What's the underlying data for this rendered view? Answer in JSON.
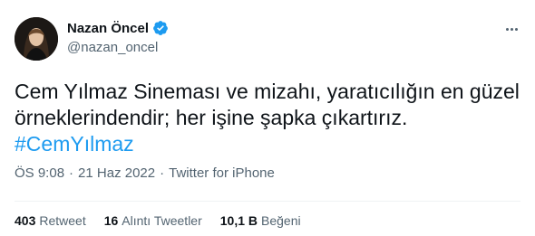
{
  "author": {
    "name": "Nazan Öncel",
    "handle": "@nazan_oncel",
    "verified": true
  },
  "tweet": {
    "line1": "Cem Yılmaz Sineması ve mizahı, yaratıcılığın en güzel",
    "line2": "örneklerindendir; her işine şapka çıkartırız.",
    "hashtag": "#CemYılmaz"
  },
  "meta": {
    "time": "ÖS 9:08",
    "separator1": "·",
    "date": "21 Haz 2022",
    "separator2": "·",
    "source": "Twitter for iPhone"
  },
  "stats": {
    "retweets_count": "403",
    "retweets_label": "Retweet",
    "quotes_count": "16",
    "quotes_label": "Alıntı Tweetler",
    "likes_count": "10,1 B",
    "likes_label": "Beğeni"
  },
  "colors": {
    "accent": "#1d9bf0",
    "text_primary": "#0f1419",
    "text_secondary": "#536471",
    "divider": "#eff3f4"
  },
  "icons": {
    "verified": "verified-badge-icon",
    "more": "more-options-icon"
  }
}
